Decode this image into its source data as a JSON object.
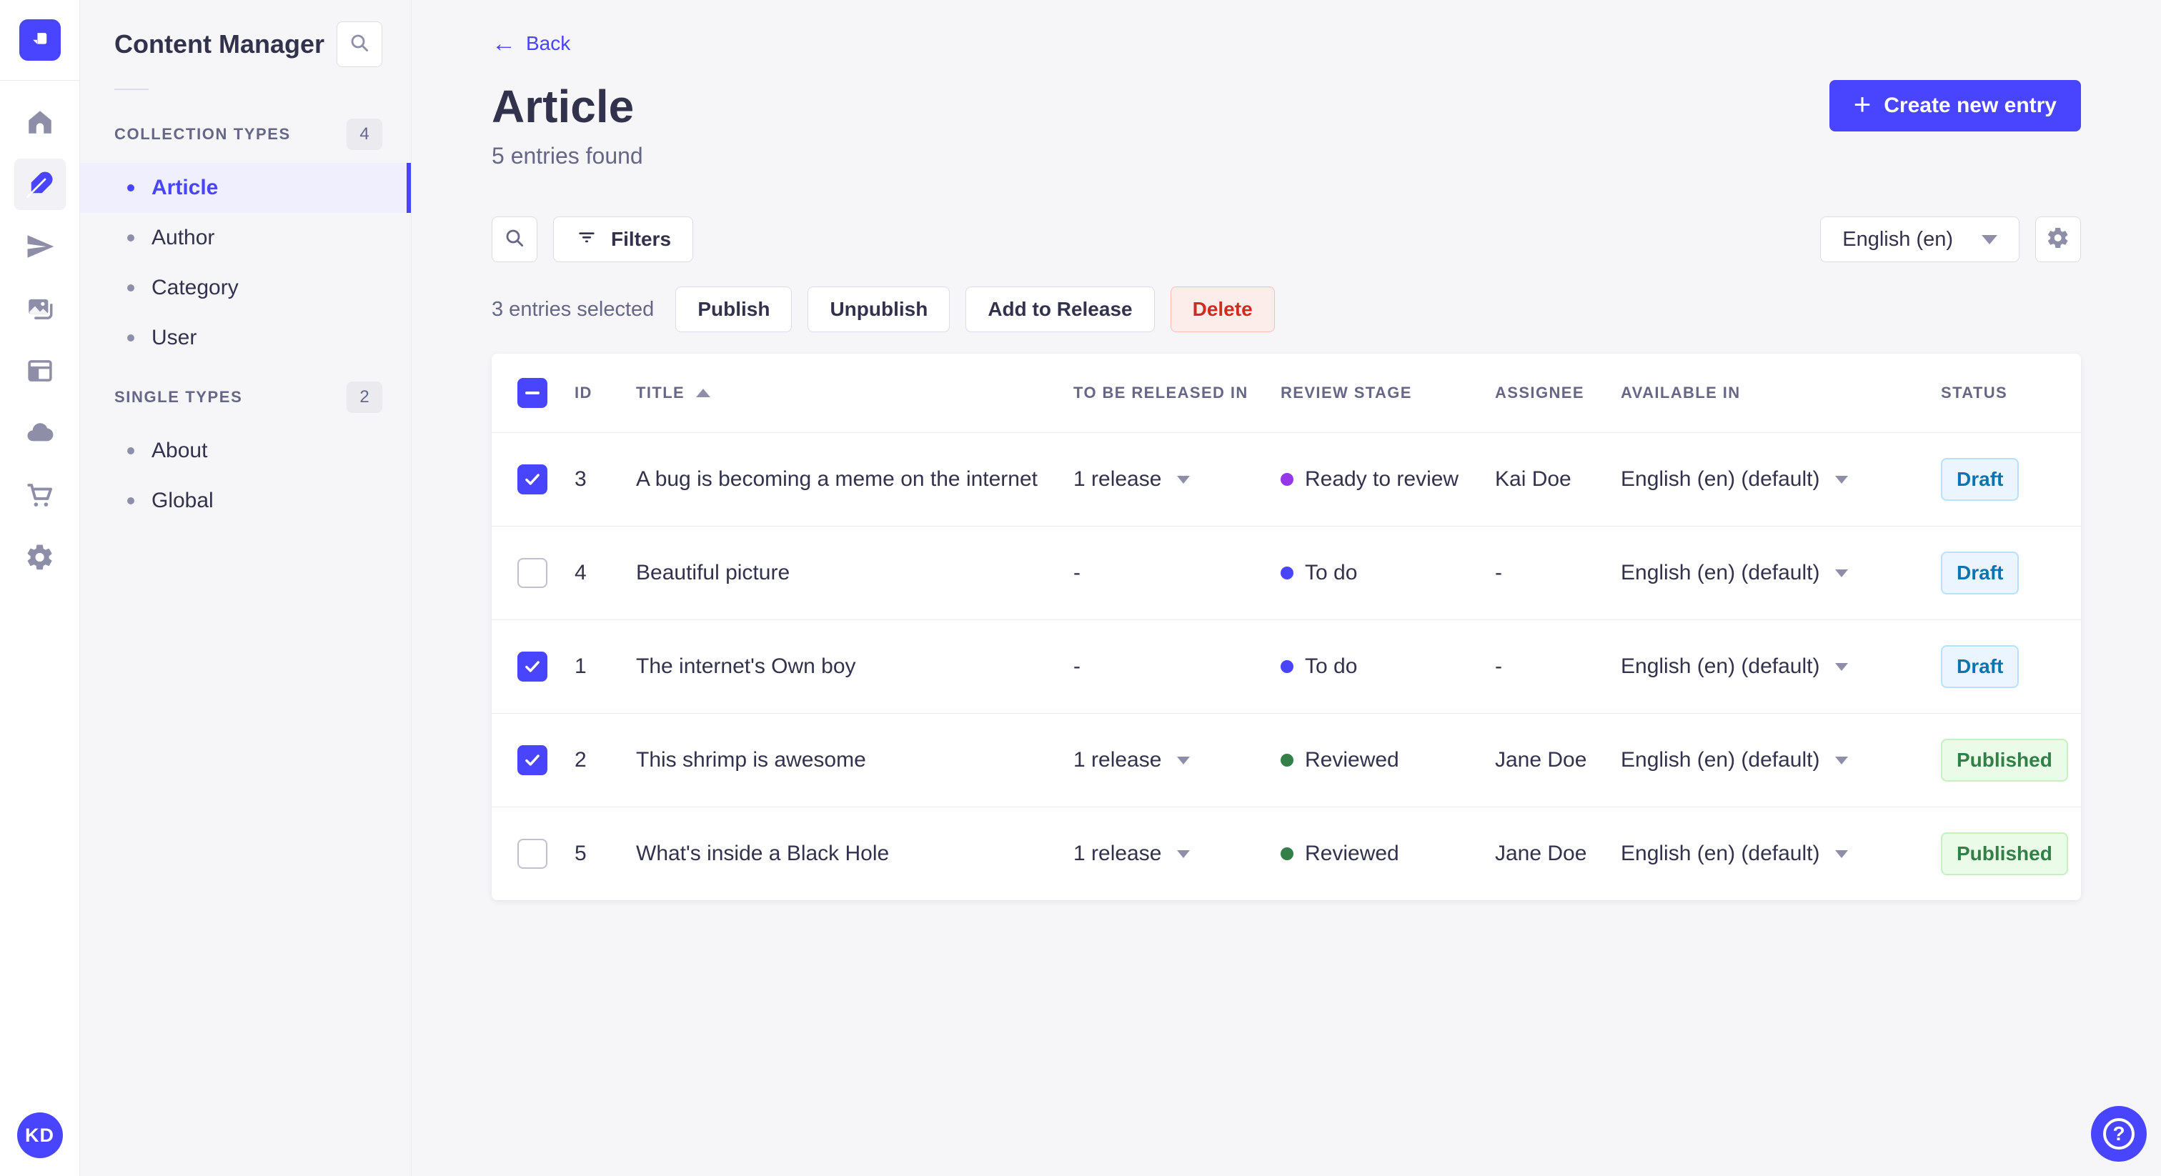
{
  "iconbar": {
    "logo_icon": "strapi-logo",
    "icons": [
      "home-icon",
      "content-manager-icon",
      "releases-icon",
      "media-library-icon",
      "content-type-builder-icon",
      "deploy-icon",
      "marketplace-icon",
      "settings-icon"
    ],
    "avatar_initials": "KD"
  },
  "subnav": {
    "title": "Content Manager",
    "search_icon": "search-icon",
    "sections": [
      {
        "label": "COLLECTION TYPES",
        "count": "4",
        "items": [
          {
            "label": "Article",
            "active": true
          },
          {
            "label": "Author",
            "active": false
          },
          {
            "label": "Category",
            "active": false
          },
          {
            "label": "User",
            "active": false
          }
        ]
      },
      {
        "label": "SINGLE TYPES",
        "count": "2",
        "items": [
          {
            "label": "About",
            "active": false
          },
          {
            "label": "Global",
            "active": false
          }
        ]
      }
    ]
  },
  "header": {
    "back_label": "Back",
    "title": "Article",
    "subtitle": "5 entries found",
    "create_button_label": "Create new entry"
  },
  "toolbar": {
    "filters_label": "Filters",
    "locale_value": "English (en)"
  },
  "selection": {
    "summary": "3 entries selected",
    "publish_label": "Publish",
    "unpublish_label": "Unpublish",
    "add_to_release_label": "Add to Release",
    "delete_label": "Delete"
  },
  "table": {
    "columns": [
      "ID",
      "TITLE",
      "TO BE RELEASED IN",
      "REVIEW STAGE",
      "ASSIGNEE",
      "AVAILABLE IN",
      "STATUS"
    ],
    "sorted_column": "TITLE",
    "sort_direction": "ascending",
    "header_checkbox_state": "indeterminate",
    "rows": [
      {
        "checked": true,
        "id": "3",
        "title": "A bug is becoming a meme on the internet",
        "to_be_released_in": "1 release",
        "review_stage": "Ready to review",
        "stage_color": "#9736e8",
        "assignee": "Kai Doe",
        "available_in": "English (en) (default)",
        "status": "Draft"
      },
      {
        "checked": false,
        "id": "4",
        "title": "Beautiful picture",
        "to_be_released_in": "-",
        "review_stage": "To do",
        "stage_color": "#4945ff",
        "assignee": "-",
        "available_in": "English (en) (default)",
        "status": "Draft"
      },
      {
        "checked": true,
        "id": "1",
        "title": "The internet's Own boy",
        "to_be_released_in": "-",
        "review_stage": "To do",
        "stage_color": "#4945ff",
        "assignee": "-",
        "available_in": "English (en) (default)",
        "status": "Draft"
      },
      {
        "checked": true,
        "id": "2",
        "title": "This shrimp is awesome",
        "to_be_released_in": "1 release",
        "review_stage": "Reviewed",
        "stage_color": "#328048",
        "assignee": "Jane Doe",
        "available_in": "English (en) (default)",
        "status": "Published"
      },
      {
        "checked": false,
        "id": "5",
        "title": "What's inside a Black Hole",
        "to_be_released_in": "1 release",
        "review_stage": "Reviewed",
        "stage_color": "#328048",
        "assignee": "Jane Doe",
        "available_in": "English (en) (default)",
        "status": "Published"
      }
    ]
  },
  "help": {
    "icon": "question-mark-icon"
  },
  "colors": {
    "primary": "#4945ff",
    "active_item_bg": "#efeffd",
    "draft_bg": "#eaf5ff",
    "draft_border": "#b8e1ff",
    "draft_text": "#0c75af",
    "published_bg": "#eafbe7",
    "published_border": "#c6f0c2",
    "published_text": "#328048",
    "delete_bg": "#fcecea",
    "delete_border": "#f5c0b8",
    "delete_text": "#d02b20",
    "stage_todo": "#4945ff",
    "stage_ready_to_review": "#9736e8",
    "stage_reviewed": "#328048"
  }
}
